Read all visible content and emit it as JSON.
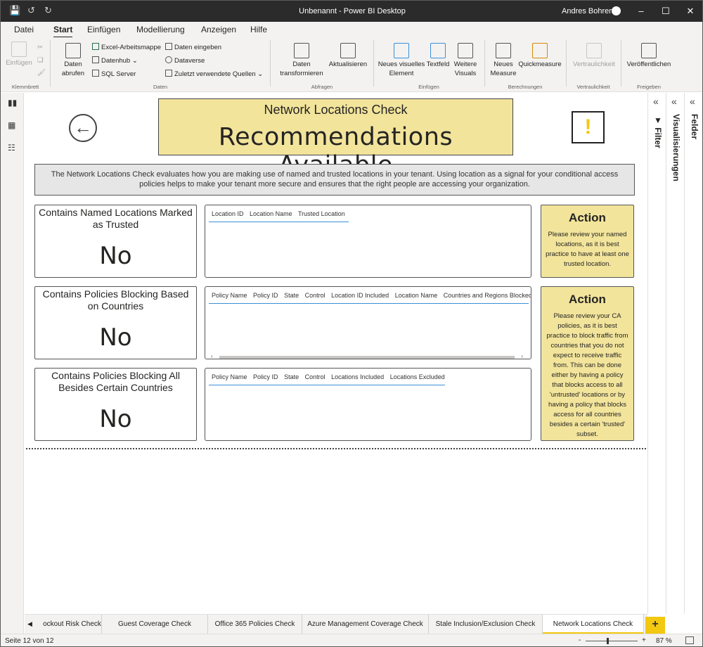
{
  "window": {
    "title": "Unbenannt - Power BI Desktop",
    "user": "Andres Bohren"
  },
  "menu": [
    "Datei",
    "Start",
    "Einfügen",
    "Modellierung",
    "Anzeigen",
    "Hilfe"
  ],
  "ribbon": {
    "einfuegen": "Einfügen",
    "daten_abrufen": "Daten abrufen",
    "excel": "Excel-Arbeitsmappe",
    "datenhub": "Datenhub",
    "sql": "SQL Server",
    "daten_eingeben": "Daten eingeben",
    "dataverse": "Dataverse",
    "zuletzt": "Zuletzt verwendete Quellen",
    "daten_transformieren": "Daten transformieren",
    "aktualisieren": "Aktualisieren",
    "neues_visuelles": "Neues visuelles Element",
    "textfeld": "Textfeld",
    "weitere_visuals": "Weitere Visuals",
    "neues_measure": "Neues Measure",
    "quickmeasure": "Quickmeasure",
    "vertraulichkeit": "Vertraulichkeit",
    "veroeffentlichen": "Veröffentlichen",
    "groups": [
      "Klemmbrett",
      "Daten",
      "Abfragen",
      "Einfügen",
      "Berechnungen",
      "Vertraulichkeit",
      "Freigeben"
    ]
  },
  "panes": {
    "filter": "Filter",
    "visualisierungen": "Visualisierungen",
    "felder": "Felder"
  },
  "report": {
    "header_sub": "Network Locations Check",
    "header_main": "Recommendations Available",
    "warning_glyph": "!",
    "description": "The Network Locations Check evaluates how you are making use of named and trusted locations in your tenant. Using location as a signal for your conditional access policies helps to make your tenant more secure and ensures that the right people are accessing your organization.",
    "cards": [
      {
        "title": "Contains Named Locations Marked as Trusted",
        "value": "No"
      },
      {
        "title": "Contains Policies Blocking Based on Countries",
        "value": "No"
      },
      {
        "title": "Contains Policies Blocking All Besides Certain Countries",
        "value": "No"
      }
    ],
    "tables": [
      {
        "columns": [
          "Location ID",
          "Location Name",
          "Trusted Location"
        ]
      },
      {
        "columns": [
          "Policy Name",
          "Policy ID",
          "State",
          "Control",
          "Location ID Included",
          "Location Name",
          "Countries and Regions Blocked"
        ]
      },
      {
        "columns": [
          "Policy Name",
          "Policy ID",
          "State",
          "Control",
          "Locations Included",
          "Locations Excluded"
        ]
      }
    ],
    "actions": [
      {
        "title": "Action",
        "text": "Please review your named locations, as it is best practice to have at least one trusted location."
      },
      {
        "title": "Action",
        "text": "Please review your CA policies, as it is best practice to block traffic from countries that you do not expect to receive traffic from. This can be done either by having a policy that blocks access to all 'untrusted' locations or by having a policy that blocks access for all countries besides a certain 'trusted' subset."
      }
    ]
  },
  "tabs": [
    "ockout Risk Check",
    "Guest Coverage Check",
    "Office 365 Policies Check",
    "Azure Management Coverage Check",
    "Stale Inclusion/Exclusion Check",
    "Network Locations Check"
  ],
  "active_tab": "Network Locations Check",
  "status": {
    "page": "Seite 12 von 12",
    "zoom": "87 %"
  },
  "accent_color": "#f2c811",
  "card_fill": "#f2e49b"
}
